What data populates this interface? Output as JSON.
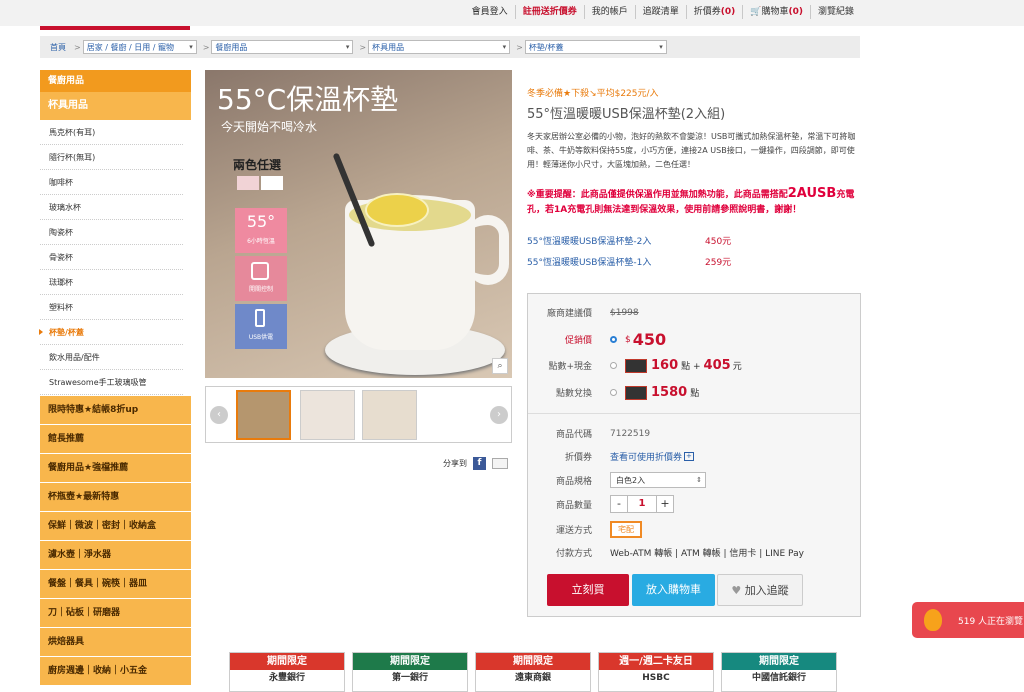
{
  "top_nav": {
    "login": "會員登入",
    "register": "註冊送折價券",
    "account": "我的帳戶",
    "wishlist": "追蹤清單",
    "coupon_label": "折價券",
    "coupon_count": "(0)",
    "cart_label": "購物車",
    "cart_count": "(0)",
    "history": "瀏覽紀錄"
  },
  "breadcrumb": {
    "home": "首頁",
    "sep": ">",
    "levels": [
      "居家 / 餐廚 / 日用 / 寵物",
      "餐廚用品",
      "杯具用品",
      "杯墊/杯蓋"
    ]
  },
  "sidebar": {
    "header": "餐廚用品",
    "sub": "杯具用品",
    "items": [
      "馬克杯(有耳)",
      "隨行杯(無耳)",
      "咖啡杯",
      "玻璃水杯",
      "陶瓷杯",
      "骨瓷杯",
      "琺瑯杯",
      "塑料杯",
      "杯墊/杯蓋",
      "飲水用品/配件",
      "Strawesome手工玻璃吸管"
    ],
    "categories": [
      "限時特惠★結帳8折up",
      "館長推薦",
      "餐廚用品★強檔推薦",
      "杯瓶壺★最新特惠",
      "保鮮｜微波｜密封｜收納盒",
      "濾水壺｜淨水器",
      "餐盤｜餐具｜碗筷｜器皿",
      "刀｜砧板｜研磨器",
      "烘焙器具",
      "廚房週邊｜收納｜小五金"
    ]
  },
  "gallery": {
    "title": "55°C保溫杯墊",
    "subtitle": "今天開始不喝冷水",
    "two_colors": "兩色任選",
    "features": [
      "6小時恆溫",
      "開關控制",
      "USB供電"
    ],
    "feature_big": "55°"
  },
  "share": {
    "label": "分享到"
  },
  "product": {
    "promo": "冬季必備★下殺↘平均$225元/入",
    "name": "55°恆溫暖暖USB保溫杯墊(2入組)",
    "description": "冬天家居辦公室必備的小物，泡好的熱飲不會變涼！USB可攜式加熱保溫杯墊，常溫下可將咖啡、茶、牛奶等飲料保持55度，小巧方便，連接2A USB接口，一鍵操作，四段調節，即可使用！輕薄迷你小尺寸，大區塊加熱，二色任選！",
    "warning_a": "※重要提醒：此商品僅提供保溫作用並無加熱功能，此商品需搭配",
    "warning_big": "2AUSB",
    "warning_b": "充電孔，若1A充電孔則無法達到保溫效果，使用前請參照說明書，謝謝！",
    "variants": [
      {
        "name": "55°恆溫暖暖USB保溫杯墊-2入",
        "price": "450元"
      },
      {
        "name": "55°恆溫暖暖USB保溫杯墊-1入",
        "price": "259元"
      }
    ]
  },
  "pricebox": {
    "msrp_label": "廠商建議價",
    "msrp": "$1998",
    "sale_label": "促銷價",
    "currency": "$",
    "sale": "450",
    "mix_label": "點數+現金",
    "mix_points": "160",
    "mix_points_unit": "點 +",
    "mix_cash": "405",
    "mix_cash_unit": "元",
    "redeem_label": "點數兌換",
    "redeem_points": "1580",
    "redeem_unit": "點",
    "code_label": "商品代碼",
    "code": "7122519",
    "coupon_label": "折價券",
    "coupon_link": "查看可使用折價券",
    "coupon_plus": "+",
    "spec_label": "商品規格",
    "spec_value": "白色2入",
    "qty_label": "商品數量",
    "qty": "1",
    "qty_minus": "-",
    "qty_plus": "+",
    "ship_label": "運送方式",
    "ship_value": "宅配",
    "pay_label": "付款方式",
    "pay_value": "Web-ATM 轉帳 | ATM 轉帳 | 信用卡 | LINE Pay",
    "buy": "立刻買",
    "add_cart": "放入購物車",
    "track": "加入追蹤"
  },
  "banks": [
    {
      "head": "期間限定",
      "name": "永豐銀行",
      "color": "#d9372c"
    },
    {
      "head": "期間限定",
      "name": "第一銀行",
      "color": "#1e7a4a"
    },
    {
      "head": "期間限定",
      "name": "遠東商銀",
      "color": "#d9372c"
    },
    {
      "head": "週一/週二卡友日",
      "name": "HSBC",
      "color": "#d9372c"
    },
    {
      "head": "期間限定",
      "name": "中國信託銀行",
      "color": "#16897f"
    }
  ],
  "viewer": {
    "text": "519 人正在瀏覽"
  },
  "colors": {
    "brand_red": "#c8102e",
    "orange": "#f29a1e",
    "blue": "#29abe2"
  }
}
